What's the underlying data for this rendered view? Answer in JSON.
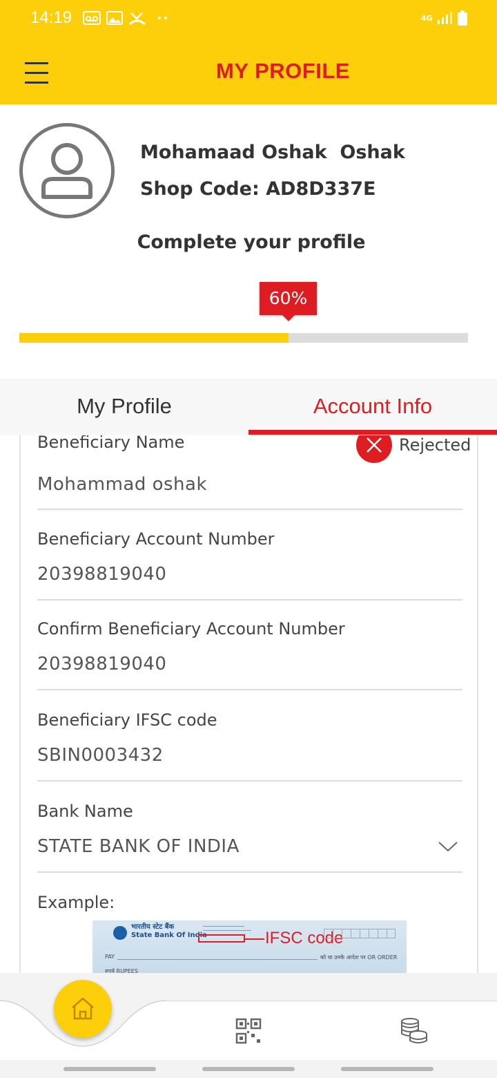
{
  "status_bar": {
    "time": "14:19",
    "network": "4G"
  },
  "header": {
    "title": "MY PROFILE"
  },
  "profile": {
    "name": "Mohamaad Oshak  Oshak",
    "shop_code": "Shop Code: AD8D337E",
    "complete_title": "Complete your profile",
    "progress_label": "60%",
    "progress_fraction": 0.6
  },
  "tabs": [
    {
      "label": "My Profile",
      "active": false
    },
    {
      "label": "Account Info",
      "active": true
    }
  ],
  "account_form": {
    "status": "Rejected",
    "fields": [
      {
        "label": "Beneficiary Name",
        "value": "Mohammad oshak"
      },
      {
        "label": "Beneficiary Account Number",
        "value": "20398819040"
      },
      {
        "label": "Confirm Beneficiary Account Number",
        "value": "20398819040"
      },
      {
        "label": "Beneficiary IFSC code",
        "value": "SBIN0003432"
      },
      {
        "label": "Bank Name",
        "value": "STATE BANK OF INDIA"
      }
    ],
    "example_label": "Example:",
    "example_image": {
      "bank_name_hi": "भारतीय स्टेट बैंक",
      "bank_name_en": "State Bank Of India",
      "annotation": "IFSC code",
      "pay_label": "PAY",
      "rupees_label": "रुपये RUPEES",
      "order_text": "को या उनके आदेश पर OR ORDER"
    }
  },
  "bottom_nav": {
    "items": [
      {
        "icon": "home-icon",
        "active": true
      },
      {
        "icon": "qr-code-icon",
        "active": false
      },
      {
        "icon": "coins-icon",
        "active": false
      }
    ]
  },
  "colors": {
    "brand_yellow": "#fccf0a",
    "brand_red": "#dd1d21"
  }
}
